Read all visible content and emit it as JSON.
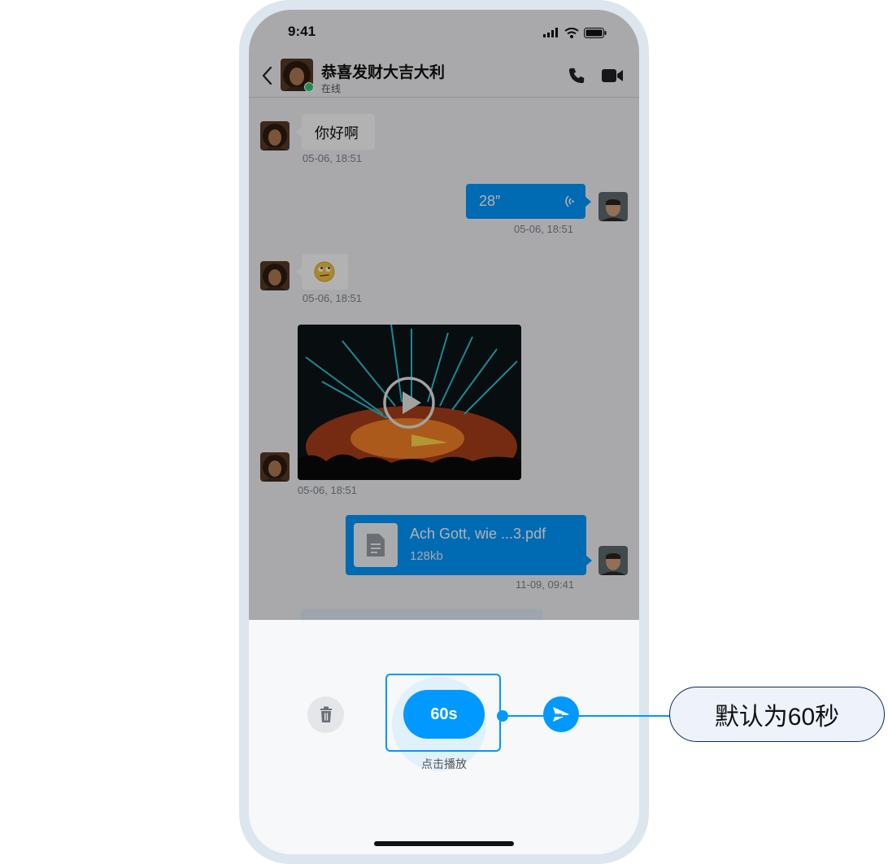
{
  "status_bar": {
    "time": "9:41"
  },
  "header": {
    "contact_name": "恭喜发财大吉大利",
    "status": "在线"
  },
  "messages": {
    "m1": {
      "text": "你好啊",
      "time": "05-06, 18:51"
    },
    "m2": {
      "duration": "28″",
      "time": "05-06, 18:51"
    },
    "m3": {
      "emoji": "🙄",
      "time": "05-06, 18:51"
    },
    "m4": {
      "time": "05-06, 18:51"
    },
    "m5": {
      "file_name": "Ach Gott, wie ...3.pdf",
      "file_size": "128kb",
      "time": "11-09, 09:41"
    }
  },
  "voice_panel": {
    "record_label": "60s",
    "hint": "点击播放"
  },
  "annotation": {
    "text": "默认为60秒"
  },
  "colors": {
    "accent": "#0099ff",
    "online": "#2ecc71",
    "overlay": "rgba(0,0,0,0.30)"
  },
  "icons": [
    "chevron-left-icon",
    "phone-icon",
    "video-camera-icon",
    "wave-icon",
    "play-icon",
    "document-icon",
    "trash-icon",
    "send-icon"
  ]
}
